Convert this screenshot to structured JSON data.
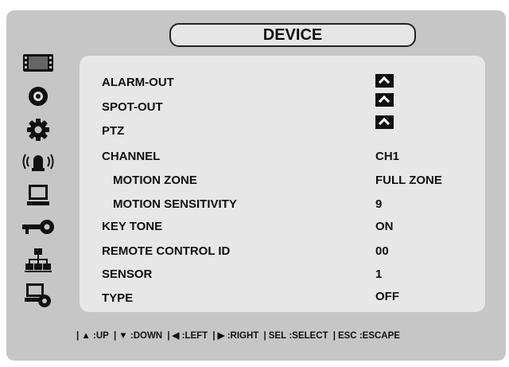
{
  "title": "DEVICE",
  "sidebar": {
    "icons": [
      "monitor-icon",
      "record-icon",
      "gear-icon",
      "alarm-light-icon",
      "display-icon",
      "key-icon",
      "network-icon",
      "system-icon"
    ]
  },
  "menu": [
    {
      "label": "ALARM-OUT",
      "value": null,
      "caret": true
    },
    {
      "label": "SPOT-OUT",
      "value": null,
      "caret": true
    },
    {
      "label": "PTZ",
      "value": null,
      "caret": true
    },
    {
      "label": "CHANNEL",
      "value": "CH1"
    },
    {
      "label": "MOTION ZONE",
      "value": "FULL ZONE",
      "indent": true
    },
    {
      "label": "MOTION SENSITIVITY",
      "value": "9",
      "indent": true
    },
    {
      "label": "KEY TONE",
      "value": "ON"
    },
    {
      "label": "REMOTE CONTROL ID",
      "value": "00"
    },
    {
      "label": "SENSOR",
      "value": "1"
    },
    {
      "label": "TYPE",
      "value": "OFF"
    }
  ],
  "hints": {
    "up": "UP",
    "down": "DOWN",
    "left": "LEFT",
    "right": "RIGHT",
    "sel_key": "SEL",
    "sel": "SELECT",
    "esc_key": "ESC",
    "esc": "ESCAPE"
  }
}
